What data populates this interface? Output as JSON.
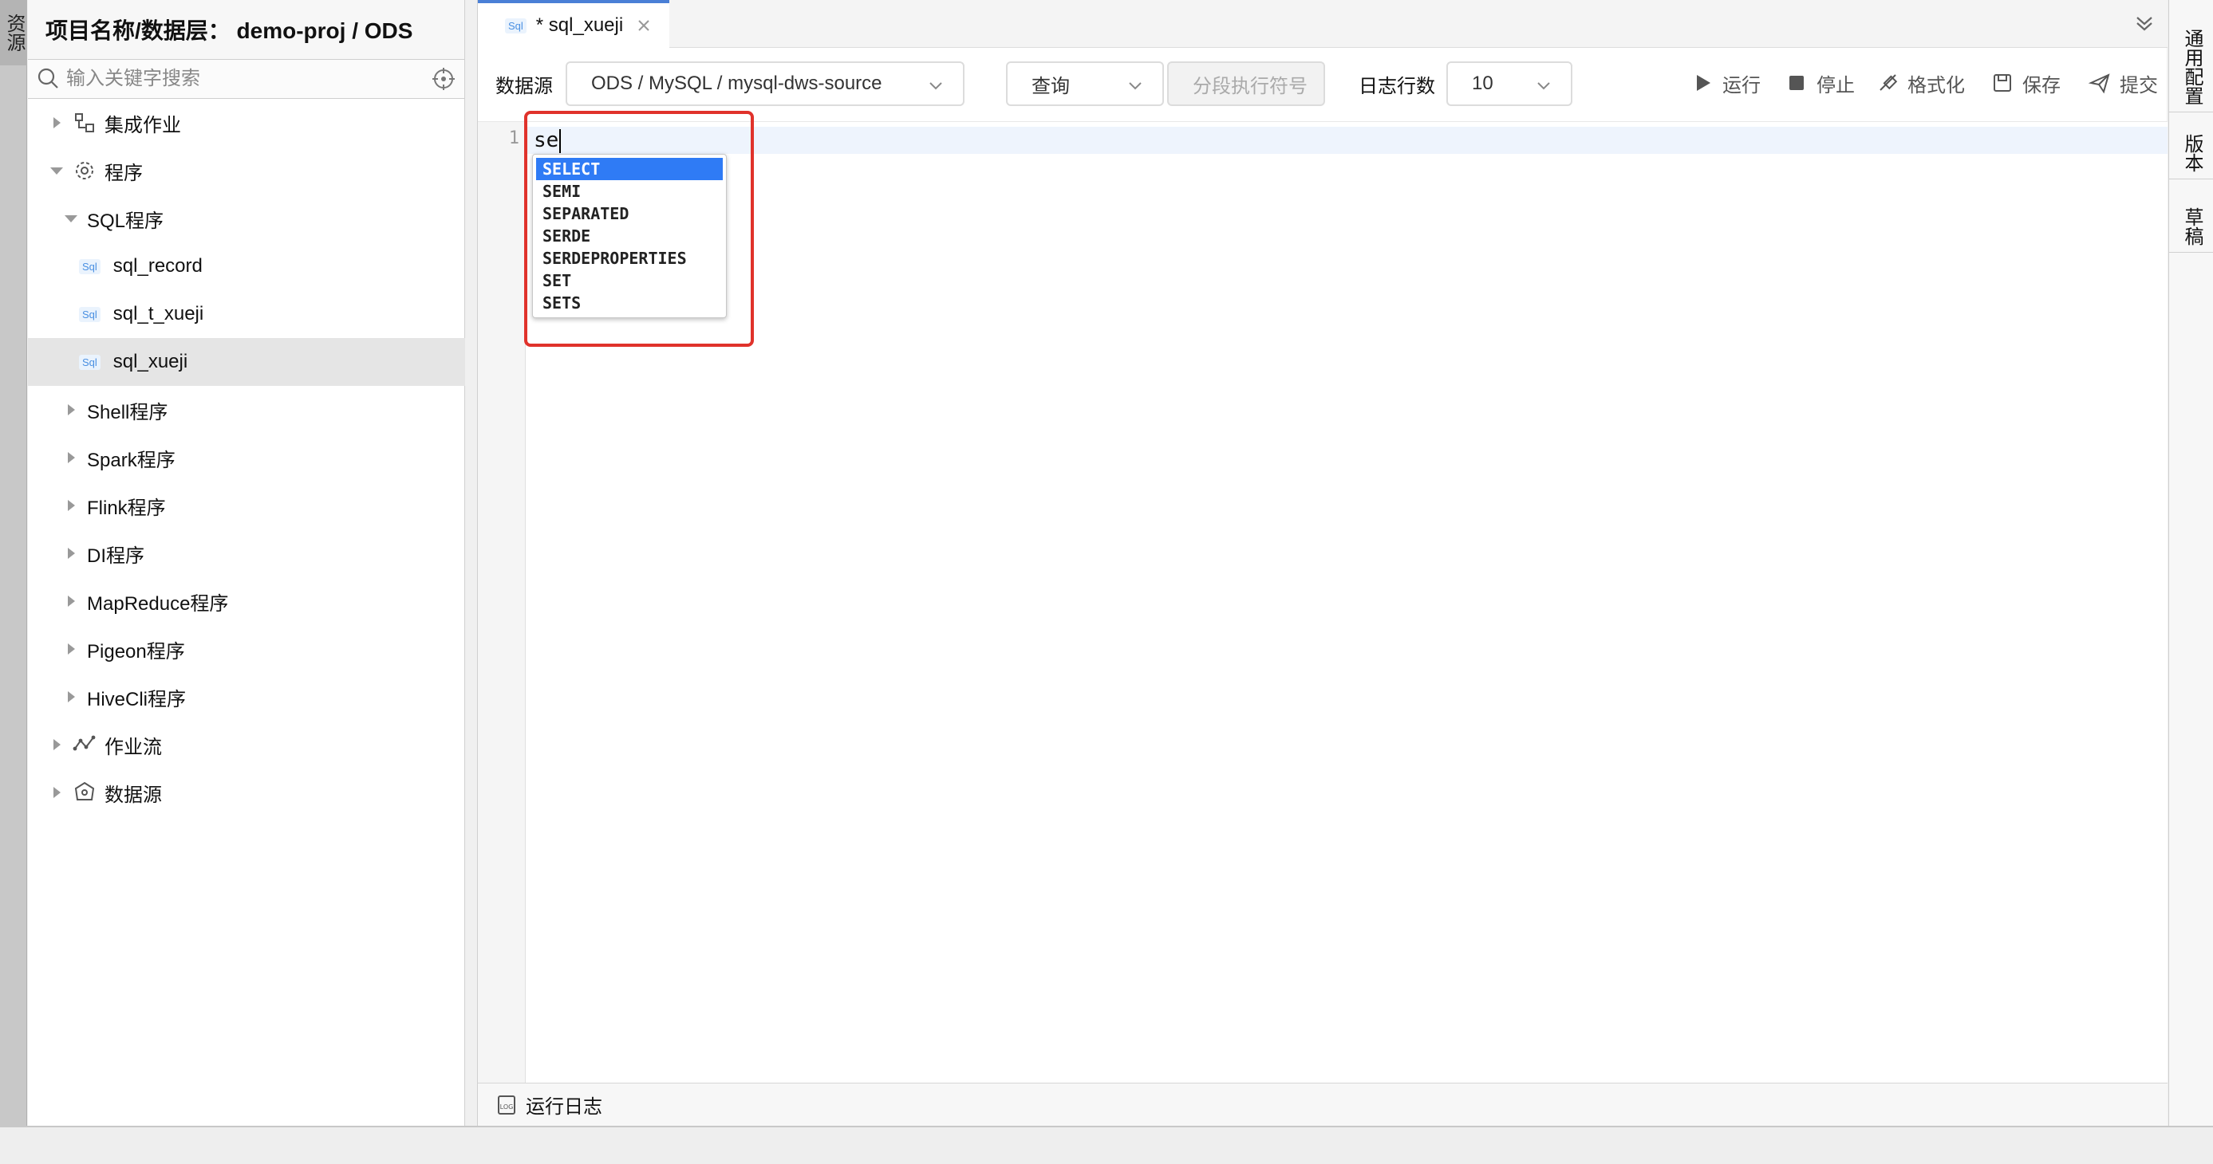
{
  "left_strip": {
    "tab_label": "资源"
  },
  "sidebar": {
    "project_header": "项目名称/数据层： demo-proj / ODS",
    "search_placeholder": "输入关键字搜索",
    "tree": {
      "integration": "集成作业",
      "programs": "程序",
      "sql_programs": "SQL程序",
      "sql_record": "sql_record",
      "sql_t_xueji": "sql_t_xueji",
      "sql_xueji": "sql_xueji",
      "shell": "Shell程序",
      "spark": "Spark程序",
      "flink": "Flink程序",
      "di": "DI程序",
      "mapreduce": "MapReduce程序",
      "pigeon": "Pigeon程序",
      "hivecli": "HiveCli程序",
      "workflow": "作业流",
      "datasource": "数据源"
    },
    "sql_badge": "Sql"
  },
  "tab": {
    "label": "* sql_xueji",
    "badge": "Sql"
  },
  "toolbar": {
    "datasource_label": "数据源",
    "datasource_value": "ODS / MySQL / mysql-dws-source",
    "mode_value": "查询",
    "segment_placeholder": "分段执行符号",
    "log_rows_label": "日志行数",
    "log_rows_value": "10",
    "run": "运行",
    "stop": "停止",
    "format": "格式化",
    "save": "保存",
    "submit": "提交"
  },
  "editor": {
    "line_number": "1",
    "code": "se",
    "autocomplete": [
      "SELECT",
      "SEMI",
      "SEPARATED",
      "SERDE",
      "SERDEPROPERTIES",
      "SET",
      "SETS"
    ],
    "selected_index": 0
  },
  "log_bar": {
    "label": "运行日志"
  },
  "right_tabs": {
    "general": "通用配置",
    "version": "版本",
    "draft": "草稿"
  },
  "colors": {
    "accent": "#2f7bf5",
    "highlight_border": "#e0322b",
    "tab_top": "#4a7fd6"
  }
}
